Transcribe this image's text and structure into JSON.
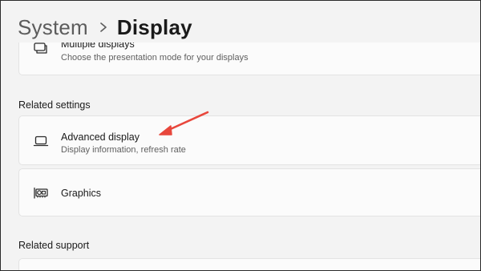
{
  "breadcrumb": {
    "parent": "System",
    "current": "Display"
  },
  "cards": {
    "multiple_displays": {
      "title": "Multiple displays",
      "subtitle": "Choose the presentation mode for your displays",
      "icon": "multiple-displays-icon"
    },
    "advanced_display": {
      "title": "Advanced display",
      "subtitle": "Display information, refresh rate",
      "icon": "laptop-icon"
    },
    "graphics": {
      "title": "Graphics",
      "icon": "graphics-card-icon"
    }
  },
  "sections": {
    "related_settings": "Related settings",
    "related_support": "Related support"
  },
  "annotation": {
    "arrow_color": "#e8473c"
  },
  "colors": {
    "background": "#f3f3f3",
    "card": "#fbfbfb",
    "border": "#e3e3e3"
  }
}
